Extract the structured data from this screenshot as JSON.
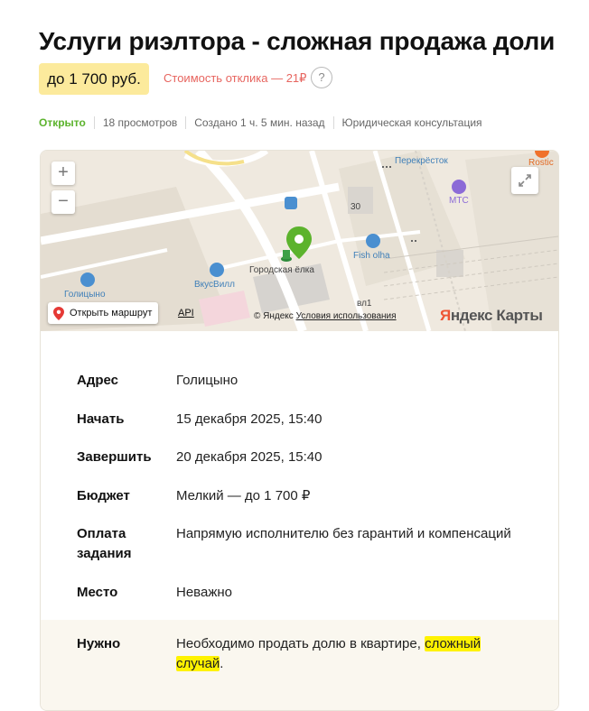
{
  "task": {
    "title": "Услуги риэлтора - сложная продажа доли",
    "price_badge": "до 1 700 руб.",
    "response_cost": "Стоимость отклика — 21₽",
    "help_symbol": "?"
  },
  "meta": {
    "status": "Открыто",
    "views": "18 просмотров",
    "created": "Создано 1 ч. 5 мин. назад",
    "category": "Юридическая консультация"
  },
  "map": {
    "zoom_in": "+",
    "zoom_out": "−",
    "route_button": "Открыть маршрут",
    "api_link": "API",
    "copyright": "© Яндекс",
    "terms_link": "Условия использования",
    "logo_y": "Я",
    "logo_rest": "ндекс Карты",
    "labels": {
      "perekrestok": "Перекрёсток",
      "mts": "МТС",
      "rostic": "Rostic",
      "fish_olha": "Fish olha",
      "gorodskaya_elka": "Городская ёлка",
      "vkusvill": "ВкусВилл",
      "golitsyno": "Голицыно",
      "house_30": "30",
      "vl1": "вл1"
    },
    "colors": {
      "pin": "#5cb32d",
      "poi": "#3f7fb8",
      "route_pin": "#e53935"
    }
  },
  "details": {
    "address_label": "Адрес",
    "address_value": "Голицыно",
    "start_label": "Начать",
    "start_value": "15 декабря 2025, 15:40",
    "end_label": "Завершить",
    "end_value": "20 декабря 2025, 15:40",
    "budget_label": "Бюджет",
    "budget_value": "Мелкий — до 1 700 ₽",
    "payment_label_1": "Оплата",
    "payment_label_2": "задания",
    "payment_value": "Напрямую исполнителю без гарантий и компенсаций",
    "place_label": "Место",
    "place_value": "Неважно",
    "need_label": "Нужно",
    "need_text_1": "Необходимо продать долю в квартире, ",
    "need_highlight_1": "сложный",
    "need_highlight_2": "случай",
    "need_text_end": "."
  }
}
